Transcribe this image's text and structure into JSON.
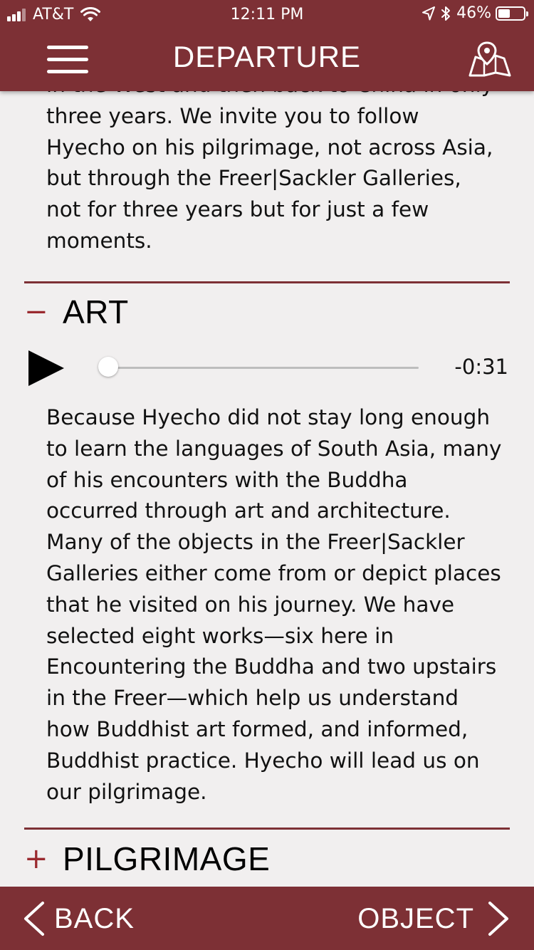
{
  "status_bar": {
    "carrier": "AT&T",
    "time": "12:11 PM",
    "battery_percent": "46%",
    "battery_level": 0.46,
    "signal_bars": 3,
    "icons": [
      "signal-bars-icon",
      "wifi-icon",
      "location-arrow-icon",
      "bluetooth-icon",
      "battery-icon"
    ]
  },
  "header": {
    "title": "DEPARTURE",
    "menu_icon": "hamburger-menu-icon",
    "map_icon": "map-pin-icon"
  },
  "intro": {
    "text": "in the West and then back to China in only three years. We invite you to follow Hyecho on his pilgrimage, not across Asia, but through the Freer|Sackler Galleries, not for three years but for just a few moments."
  },
  "sections": [
    {
      "toggle": "−",
      "title": "ART",
      "expanded": true,
      "audio": {
        "play_icon": "play-icon",
        "time_remaining": "-0:31",
        "progress": 0.0
      },
      "text": "Because Hyecho did not stay long enough to learn the languages of South Asia, many of his encounters with the Buddha occurred through art and architecture. Many of the objects in the Freer|Sackler Galleries either come from or depict places that he visited on his journey. We have selected eight works—six here in Encountering the Buddha and two upstairs in the Freer—which help us understand how Buddhist art formed, and informed, Buddhist practice. Hyecho will lead us on our pilgrimage."
    },
    {
      "toggle": "+",
      "title": "PILGRIMAGE",
      "expanded": false
    }
  ],
  "footer": {
    "back_label": "BACK",
    "next_label": "OBJECT",
    "back_icon": "chevron-left-icon",
    "next_icon": "chevron-right-icon"
  },
  "colors": {
    "brand": "#7d3035",
    "background": "#f1efef",
    "accent_toggle": "#9a2a2f",
    "text": "#111111"
  }
}
